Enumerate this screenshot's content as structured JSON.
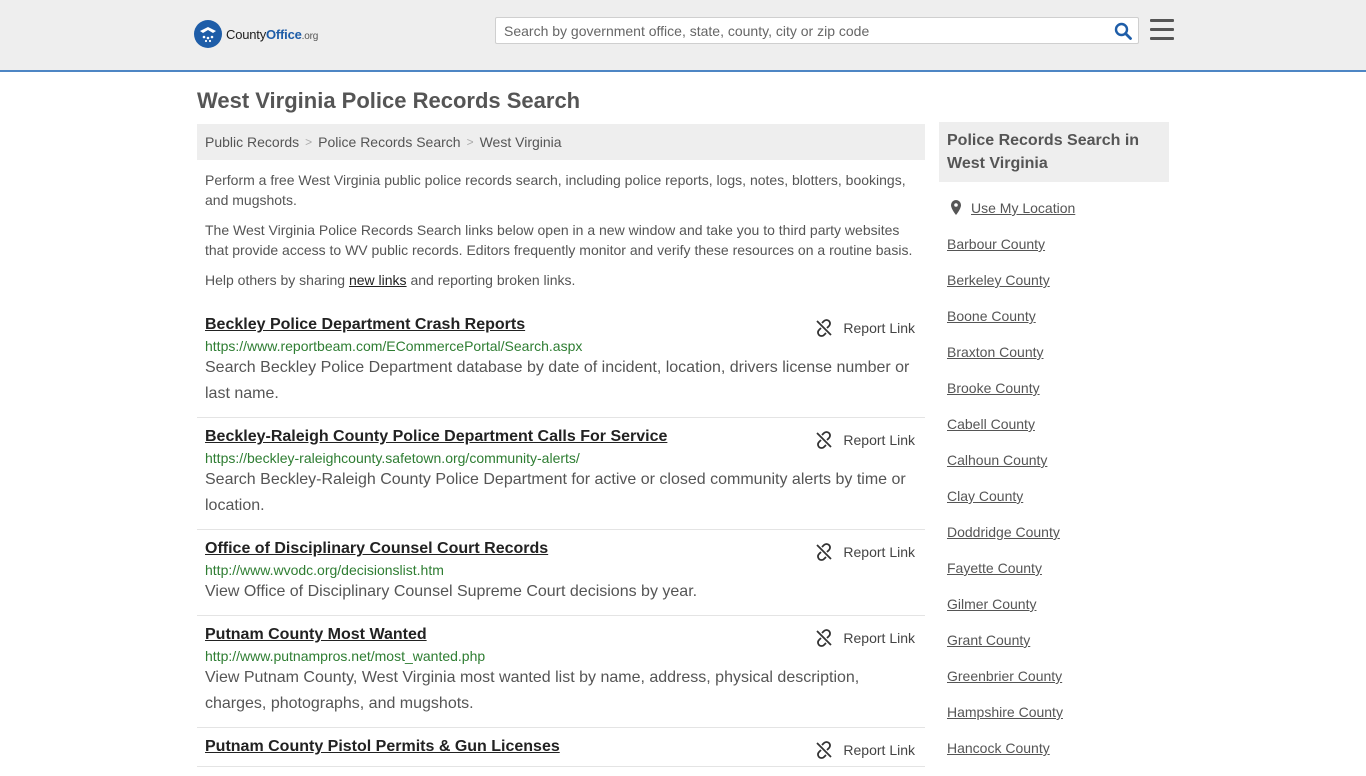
{
  "header": {
    "logo": {
      "prefix": "County",
      "brand": "Office",
      "suffix": ".org"
    },
    "search": {
      "placeholder": "Search by government office, state, county, city or zip code"
    },
    "accent_color": "#4e86c4",
    "search_icon": "search-icon",
    "menu_icon": "hamburger-menu-icon"
  },
  "page": {
    "title": "West Virginia Police Records Search",
    "breadcrumb": [
      "Public Records",
      "Police Records Search",
      "West Virginia"
    ],
    "intro": {
      "p1": "Perform a free West Virginia public police records search, including police reports, logs, notes, blotters, bookings, and mugshots.",
      "p2": "The West Virginia Police Records Search links below open in a new window and take you to third party websites that provide access to WV public records. Editors frequently monitor and verify these resources on a routine basis.",
      "p3_before": "Help others by sharing ",
      "p3_link": "new links",
      "p3_after": " and reporting broken links."
    }
  },
  "results": [
    {
      "title": "Beckley Police Department Crash Reports",
      "url": "https://www.reportbeam.com/ECommercePortal/Search.aspx",
      "desc": "Search Beckley Police Department database by date of incident, location, drivers license number or last name.",
      "report_label": "Report Link"
    },
    {
      "title": "Beckley-Raleigh County Police Department Calls For Service",
      "url": "https://beckley-raleighcounty.safetown.org/community-alerts/",
      "desc": "Search Beckley-Raleigh County Police Department for active or closed community alerts by time or location.",
      "report_label": "Report Link"
    },
    {
      "title": "Office of Disciplinary Counsel Court Records",
      "url": "http://www.wvodc.org/decisionslist.htm",
      "desc": "View Office of Disciplinary Counsel Supreme Court decisions by year.",
      "report_label": "Report Link"
    },
    {
      "title": "Putnam County Most Wanted",
      "url": "http://www.putnampros.net/most_wanted.php",
      "desc": "View Putnam County, West Virginia most wanted list by name, address, physical description, charges, photographs, and mugshots.",
      "report_label": "Report Link"
    },
    {
      "title": "Putnam County Pistol Permits & Gun Licenses",
      "url": "",
      "desc": "",
      "report_label": "Report Link"
    }
  ],
  "sidebar": {
    "heading": "Police Records Search in West Virginia",
    "use_location": "Use My Location",
    "counties": [
      "Barbour County",
      "Berkeley County",
      "Boone County",
      "Braxton County",
      "Brooke County",
      "Cabell County",
      "Calhoun County",
      "Clay County",
      "Doddridge County",
      "Fayette County",
      "Gilmer County",
      "Grant County",
      "Greenbrier County",
      "Hampshire County",
      "Hancock County"
    ]
  }
}
